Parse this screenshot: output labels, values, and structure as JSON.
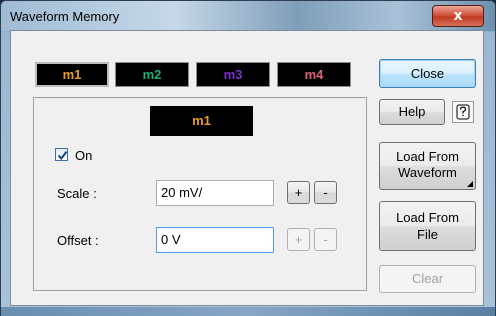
{
  "window": {
    "title": "Waveform Memory",
    "close_glyph": "x"
  },
  "memory_tabs": [
    {
      "label": "m1",
      "color": "#e89b2b",
      "selected": true
    },
    {
      "label": "m2",
      "color": "#1fb071",
      "selected": false
    },
    {
      "label": "m3",
      "color": "#7a2fd1",
      "selected": false
    },
    {
      "label": "m4",
      "color": "#e0607a",
      "selected": false
    }
  ],
  "panel": {
    "selected_label": "m1",
    "on_checkbox": {
      "label": "On",
      "checked": true
    },
    "scale": {
      "label": "Scale :",
      "value": "20 mV/",
      "plus": "+",
      "minus": "-"
    },
    "offset": {
      "label": "Offset :",
      "value": "0 V",
      "plus": "+",
      "minus": "-"
    }
  },
  "buttons": {
    "close": "Close",
    "help": "Help",
    "help_icon": "?",
    "load_from_waveform_line1": "Load From",
    "load_from_waveform_line2": "Waveform",
    "load_from_file_line1": "Load From",
    "load_from_file_line2": "File",
    "clear": "Clear"
  }
}
